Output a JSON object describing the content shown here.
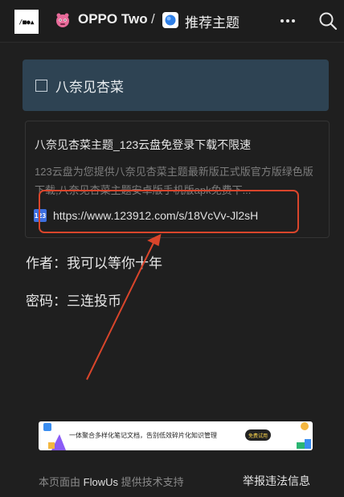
{
  "header": {
    "logo_text": "/■●▲",
    "workspace_name": "OPPO Two",
    "separator": "/",
    "page_title": "推荐主题",
    "workspace_icon": "pink-monster-icon",
    "page_icon": "blue-circle-icon",
    "more_icon": "more-dots-icon",
    "search_icon": "search-icon"
  },
  "callout": {
    "icon": "box-icon",
    "text": "八奈见杏菜"
  },
  "bookmark": {
    "title": "八奈见杏菜主题_123云盘免登录下载不限速",
    "description": "123云盘为您提供八奈见杏菜主题最新版正式版官方版绿色版下载,八奈见杏菜主题安卓版手机版apk免费下...",
    "favicon_text": "123",
    "url": "https://www.123912.com/s/18VcVv-Jl2sH"
  },
  "content": {
    "author_line": "作者：我可以等你十年",
    "password_line": "密码：三连投币"
  },
  "annotation_color": "#d9452b",
  "banner": {
    "text": "一体聚合多样化笔记文档，告别低效碎片化知识管理",
    "badge": "免费试用"
  },
  "footer": {
    "prefix": "本页面由",
    "brand": "FlowUs",
    "suffix": "提供技术支持",
    "report_link": "举报违法信息"
  }
}
